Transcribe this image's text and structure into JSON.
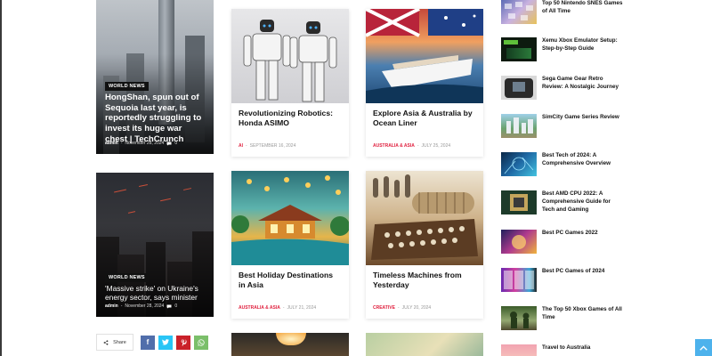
{
  "featured": [
    {
      "category": "WORLD NEWS",
      "title": "HongShan, spun out of Sequoia last year, is reportedly struggling to invest its huge war chest | TechCrunch",
      "author": "admin",
      "separator": "-",
      "date": "November 28, 2024",
      "comments": "0"
    },
    {
      "category": "WORLD NEWS",
      "title": "'Massive strike' on Ukraine's energy sector, says minister",
      "author": "admin",
      "separator": "-",
      "date": "November 28, 2024",
      "comments": "0"
    }
  ],
  "articles": [
    {
      "title": "Revolutionizing Robotics: Honda ASIMO",
      "category": "AI",
      "separator": "-",
      "date": "SEPTEMBER 16, 2024"
    },
    {
      "title": "Explore Asia & Australia by Ocean Liner",
      "category": "AUSTRALIA & ASIA",
      "separator": "-",
      "date": "JULY 25, 2024"
    },
    {
      "title": "Best Holiday Destinations in Asia",
      "category": "AUSTRALIA & ASIA",
      "separator": "-",
      "date": "JULY 21, 2024"
    },
    {
      "title": "Timeless Machines from Yesterday",
      "category": "CREATIVE",
      "separator": "-",
      "date": "JULY 20, 2024"
    }
  ],
  "share": {
    "label": "Share",
    "facebook_icon": "f",
    "twitter_icon": "t",
    "pinterest_icon": "p",
    "whatsapp_icon": "w"
  },
  "sidebar": [
    {
      "title": "Top 50 Nintendo SNES Games of All Time"
    },
    {
      "title": "Xemu Xbox Emulator Setup: Step-by-Step Guide"
    },
    {
      "title": "Sega Game Gear Retro Review: A Nostalgic Journey"
    },
    {
      "title": "SimCity Game Series Review"
    },
    {
      "title": "Best Tech of 2024: A Comprehensive Overview"
    },
    {
      "title": "Best AMD CPU 2022: A Comprehensive Guide for Tech and Gaming"
    },
    {
      "title": "Best PC Games 2022"
    },
    {
      "title": "Best PC Games of 2024"
    },
    {
      "title": "The Top 50 Xbox Games of All Time"
    },
    {
      "title": "Travel to Australia"
    }
  ],
  "colors": {
    "accent_red": "#e0213f",
    "back_to_top": "#4db2ec",
    "facebook": "#516eab",
    "twitter": "#29c5f6",
    "pinterest": "#ca212a",
    "whatsapp": "#7bbf6a"
  }
}
